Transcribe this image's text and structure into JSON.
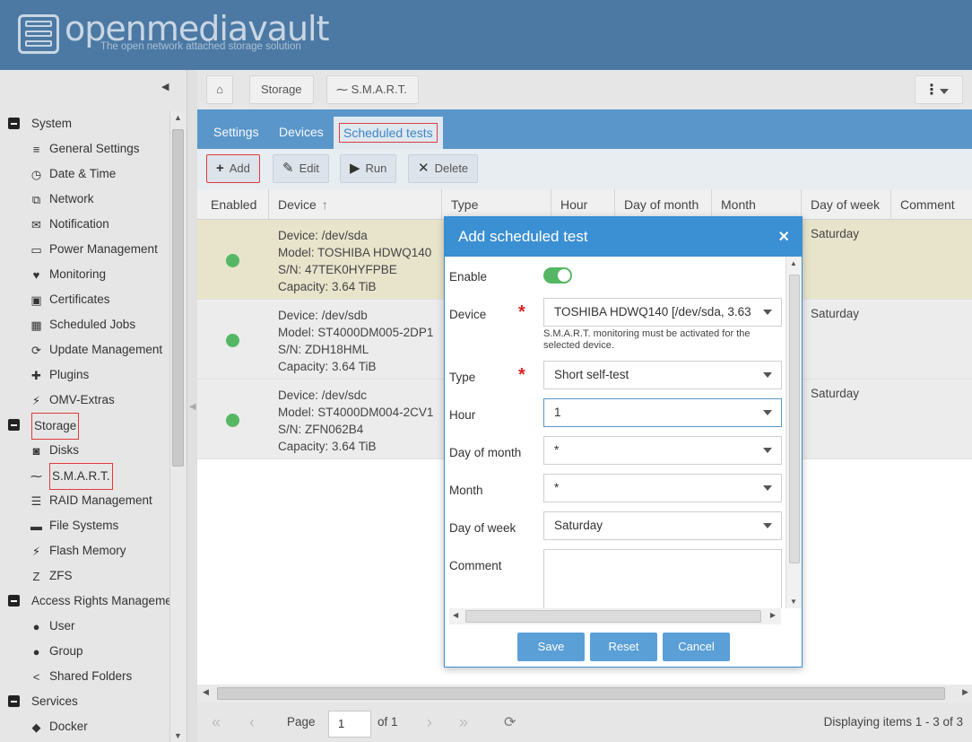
{
  "brand": {
    "name": "openmediavault",
    "tagline": "The open network attached storage solution"
  },
  "breadcrumb": {
    "items": [
      "Storage",
      "S.M.A.R.T."
    ]
  },
  "sidebar": {
    "items": [
      {
        "label": "System",
        "type": "group"
      },
      {
        "label": "General Settings",
        "icon": "sliders-icon"
      },
      {
        "label": "Date & Time",
        "icon": "clock-icon"
      },
      {
        "label": "Network",
        "icon": "network-icon"
      },
      {
        "label": "Notification",
        "icon": "envelope-icon"
      },
      {
        "label": "Power Management",
        "icon": "battery-icon"
      },
      {
        "label": "Monitoring",
        "icon": "heartbeat-icon"
      },
      {
        "label": "Certificates",
        "icon": "certificate-icon"
      },
      {
        "label": "Scheduled Jobs",
        "icon": "calendar-icon"
      },
      {
        "label": "Update Management",
        "icon": "refresh-icon"
      },
      {
        "label": "Plugins",
        "icon": "plugin-icon"
      },
      {
        "label": "OMV-Extras",
        "icon": "plug-icon"
      },
      {
        "label": "Storage",
        "type": "group"
      },
      {
        "label": "Disks",
        "icon": "disk-icon"
      },
      {
        "label": "S.M.A.R.T.",
        "icon": "pulse-icon"
      },
      {
        "label": "RAID Management",
        "icon": "database-icon"
      },
      {
        "label": "File Systems",
        "icon": "folder-icon"
      },
      {
        "label": "Flash Memory",
        "icon": "flash-icon"
      },
      {
        "label": "ZFS",
        "icon": "zfs-icon"
      },
      {
        "label": "Access Rights Manageme",
        "type": "group"
      },
      {
        "label": "User",
        "icon": "user-icon"
      },
      {
        "label": "Group",
        "icon": "users-icon"
      },
      {
        "label": "Shared Folders",
        "icon": "share-icon"
      },
      {
        "label": "Services",
        "type": "group"
      },
      {
        "label": "Docker",
        "icon": "docker-icon"
      }
    ]
  },
  "tabs": [
    {
      "label": "Settings"
    },
    {
      "label": "Devices"
    },
    {
      "label": "Scheduled tests"
    }
  ],
  "actions": {
    "add": "Add",
    "edit": "Edit",
    "run": "Run",
    "delete": "Delete"
  },
  "grid": {
    "columns": [
      "Enabled",
      "Device",
      "Type",
      "Hour",
      "Day of month",
      "Month",
      "Day of week",
      "Comment"
    ],
    "rows": [
      {
        "device": "Device: /dev/sda",
        "model": "Model: TOSHIBA HDWQ140",
        "sn": "S/N: 47TEK0HYFPBE",
        "capacity": "Capacity: 3.64 TiB",
        "dow": "Saturday"
      },
      {
        "device": "Device: /dev/sdb",
        "model": "Model: ST4000DM005-2DP1",
        "sn": "S/N: ZDH18HML",
        "capacity": "Capacity: 3.64 TiB",
        "dow": "Saturday"
      },
      {
        "device": "Device: /dev/sdc",
        "model": "Model: ST4000DM004-2CV1",
        "sn": "S/N: ZFN062B4",
        "capacity": "Capacity: 3.64 TiB",
        "dow": "Saturday"
      }
    ]
  },
  "pager": {
    "page_label": "Page",
    "page": "1",
    "of": "of 1",
    "status": "Displaying items 1 - 3 of 3"
  },
  "dialog": {
    "title": "Add scheduled test",
    "enable_label": "Enable",
    "device_label": "Device",
    "device_value": "TOSHIBA HDWQ140 [/dev/sda, 3.63",
    "device_hint": "S.M.A.R.T. monitoring must be activated for the selected device.",
    "type_label": "Type",
    "type_value": "Short self-test",
    "hour_label": "Hour",
    "hour_value": "1",
    "dom_label": "Day of month",
    "dom_value": "*",
    "month_label": "Month",
    "month_value": "*",
    "dow_label": "Day of week",
    "dow_value": "Saturday",
    "comment_label": "Comment",
    "save": "Save",
    "reset": "Reset",
    "cancel": "Cancel"
  }
}
